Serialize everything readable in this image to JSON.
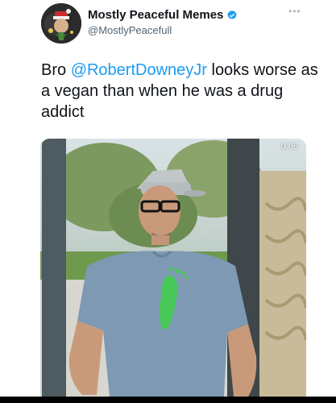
{
  "tweet": {
    "author": {
      "display_name": "Mostly Peaceful Memes",
      "handle": "@MostlyPeacefull",
      "verified": true,
      "avatar_icon": "avatar-image",
      "verified_icon": "verified-badge-icon"
    },
    "more_icon": "more-options-icon",
    "text_prefix": "Bro ",
    "mention": "@RobertDowneyJr",
    "text_suffix": " looks worse as a vegan than when he was a drug addict",
    "media": {
      "type": "video",
      "duration": "0:06"
    }
  },
  "colors": {
    "link": "#1d9bf0",
    "verified": "#1d9bf0",
    "text": "#0f1419",
    "secondary": "#536471"
  }
}
